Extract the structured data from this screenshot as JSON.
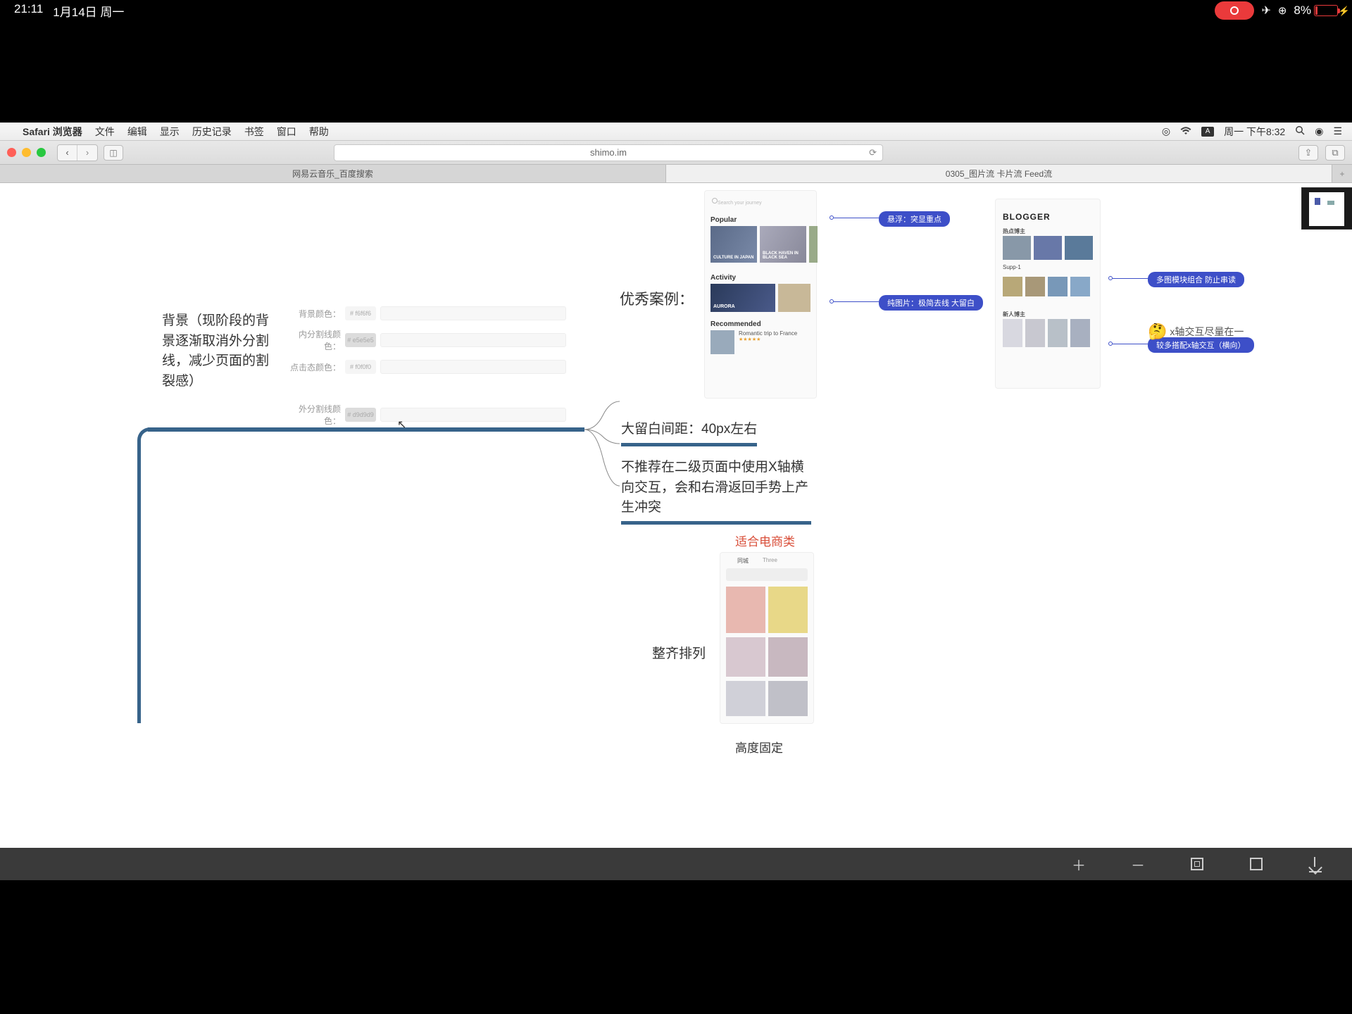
{
  "ipad_status": {
    "time": "21:11",
    "date": "1月14日 周一",
    "battery_pct": "8%"
  },
  "mac_menubar": {
    "app_name": "Safari 浏览器",
    "menus": [
      "文件",
      "编辑",
      "显示",
      "历史记录",
      "书签",
      "窗口",
      "帮助"
    ],
    "clock": "周一 下午8:32",
    "input_indicator": "A"
  },
  "safari": {
    "url": "shimo.im",
    "tabs": [
      "网易云音乐_百度搜索",
      "0305_图片流 卡片流 Feed流"
    ]
  },
  "canvas": {
    "left_node": "背景（现阶段的背景逐渐取消外分割线，减少页面的割裂感）",
    "props": {
      "bg_label": "背景颜色：",
      "bg_value": "# f6f6f6",
      "inner_label": "内分割线颜色：",
      "inner_value": "# e5e5e5",
      "state_label": "点击态颜色：",
      "state_value": "# f0f0f0",
      "outer_label": "外分割线颜色：",
      "outer_value": "# d9d9d9"
    },
    "example_title": "优秀案例：",
    "mock1": {
      "search_placeholder": "Search your journey",
      "sec_popular": "Popular",
      "card1": "CULTURE IN JAPAN",
      "card2": "BLACK HAVEN IN BLACK SEA",
      "sec_activity": "Activity",
      "aurora": "AURORA",
      "sec_recommended": "Recommended",
      "reco_title": "Romantic trip to France"
    },
    "mock2": {
      "title": "BLOGGER",
      "sec1": "热点博主",
      "name": "Supp-1",
      "sec2": "新人博主"
    },
    "pill_float": "悬浮：突显重点",
    "pill_pureimg": "纯图片：极简去线 大留白",
    "pill_multi": "多图模块组合 防止串读",
    "pill_xaxis": "较多搭配x轴交互（横向）",
    "emoji_note": "x轴交互尽量在一",
    "node_margin": "大留白间距：40px左右",
    "node_noxaxis": "不推荐在二级页面中使用X轴横向交互，会和右滑返回手势上产生冲突",
    "node_ecom": "适合电商类",
    "node_align": "整齐排列",
    "node_height": "高度固定",
    "mock3": {
      "tab1": "同城",
      "tab2": "Three"
    }
  }
}
